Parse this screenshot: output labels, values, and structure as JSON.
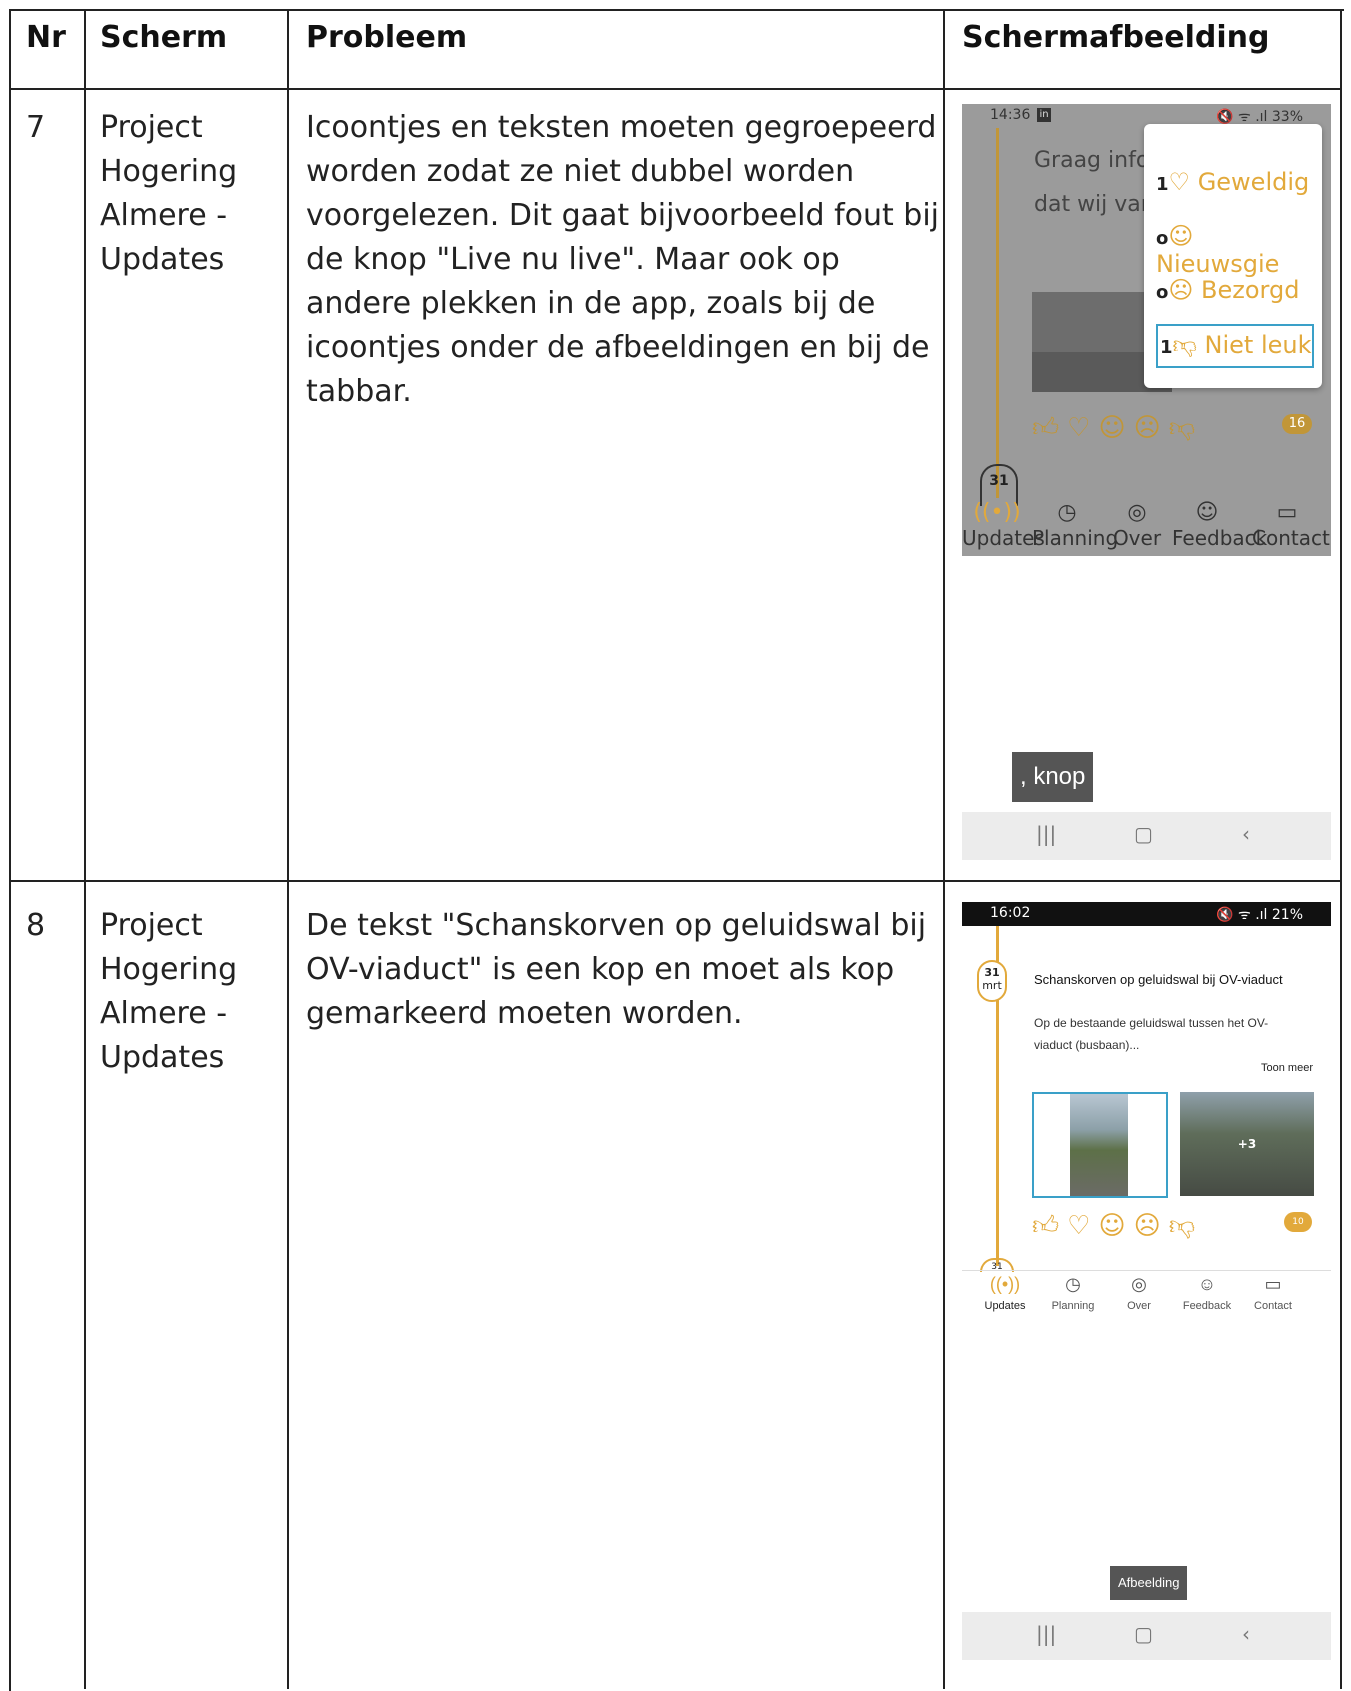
{
  "table": {
    "headers": {
      "nr": "Nr",
      "screen": "Scherm",
      "problem": "Probleem",
      "screenshot": "Schermafbeelding"
    },
    "rows": [
      {
        "nr": "7",
        "screen": [
          "Project",
          "Hogering",
          "Almere -",
          "Updates"
        ],
        "problem": [
          "Icoontjes en teksten moeten gegroepeerd",
          "worden zodat ze niet dubbel worden",
          "voorgelezen. Dit gaat bijvoorbeeld fout bij",
          "de knop \"Live nu live\". Maar ook op",
          "andere plekken in de app, zoals bij de",
          "icoontjes onder de afbeeldingen en bij de",
          "tabbar."
        ]
      },
      {
        "nr": "8",
        "screen": [
          "Project",
          "Hogering",
          "Almere -",
          "Updates"
        ],
        "problem": [
          "De tekst \"Schanskorven op geluidswal bij",
          "OV-viaduct\" is een kop en moet als kop",
          "gemarkeerd moeten worden."
        ]
      }
    ]
  },
  "shot1": {
    "time": "14:36",
    "status_right": "33%",
    "body_line1": "Graag info",
    "body_line2": "dat wij var",
    "reactions": [
      {
        "count": "1",
        "label": "Geweldig"
      },
      {
        "count": "o",
        "label": "Nieuwsgie"
      },
      {
        "count": "o",
        "label": "Bezorgd"
      },
      {
        "count": "1",
        "label": "Niet leuk"
      }
    ],
    "badge": "16",
    "date_day": "31",
    "tabs": [
      "Updates",
      "Planning",
      "Over",
      "Feedback",
      "Contact"
    ],
    "tooltip": ", knop"
  },
  "shot2": {
    "time": "16:02",
    "status_right": "21%",
    "date_day": "31",
    "date_month": "mrt",
    "title": "Schanskorven op geluidswal bij OV-viaduct",
    "body_line1": "Op de bestaande geluidswal tussen het OV-",
    "body_line2": "viaduct (busbaan)...",
    "more": "Toon meer",
    "plus": "+3",
    "badge": "10",
    "date_day2": "31",
    "tabs": [
      "Updates",
      "Planning",
      "Over",
      "Feedback",
      "Contact"
    ],
    "tooltip": "Afbeelding"
  },
  "icons": [
    "thumbs-up-icon",
    "heart-icon",
    "thinking-face-icon",
    "worried-face-icon",
    "thumbs-down-icon",
    "broadcast-icon",
    "clock-icon",
    "fingerprint-icon",
    "smiley-icon",
    "chat-icon"
  ],
  "colors": {
    "accent": "#e2a93b",
    "focus": "#3aa0c8"
  }
}
